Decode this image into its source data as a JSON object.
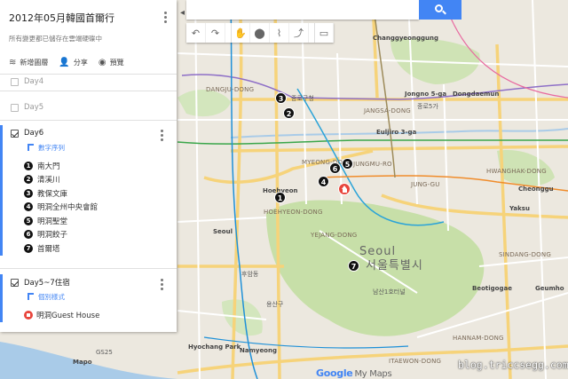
{
  "panel": {
    "title": "2012年05月韓國首爾行",
    "status": "所有變更都已儲存在雲端硬碟中",
    "actions": [
      {
        "label": "新增圖層",
        "icon": "layers-icon"
      },
      {
        "label": "分享",
        "icon": "add-person-icon"
      },
      {
        "label": "預覽",
        "icon": "eye-icon"
      }
    ],
    "layers_collapsed": [
      {
        "label": "Day4",
        "checked": false
      },
      {
        "label": "Day5",
        "checked": false
      }
    ],
    "day6": {
      "label": "Day6",
      "style_label": "數字序列",
      "places": [
        {
          "num": "1",
          "name": "南大門"
        },
        {
          "num": "2",
          "name": "清溪川"
        },
        {
          "num": "3",
          "name": "教保文庫"
        },
        {
          "num": "4",
          "name": "明洞全州中央會館"
        },
        {
          "num": "5",
          "name": "明洞聖堂"
        },
        {
          "num": "6",
          "name": "明洞餃子"
        },
        {
          "num": "7",
          "name": "首爾塔"
        }
      ]
    },
    "stay": {
      "label": "Day5~7住宿",
      "style_label": "個別樣式",
      "place": "明洞Guest House"
    }
  },
  "toolbar": {
    "tools": [
      "undo-icon",
      "redo-icon",
      "hand-icon",
      "marker-icon",
      "line-icon",
      "directions-icon",
      "ruler-icon"
    ]
  },
  "map": {
    "markers": [
      "1",
      "2",
      "3",
      "4",
      "5",
      "6",
      "7"
    ],
    "labels": {
      "changgyeong": "Changgyeonggung",
      "jongno": "Jongno 5-ga",
      "dongdaemun": "Dongdaemun",
      "jongno_ko": "종로5가",
      "jangsa": "JANGSA-DONG",
      "dangju": "DANGJU-DONG",
      "jongno_area": "종로구청",
      "euljiro": "Euljiro 3-ga",
      "myeong": "MYEONG-DONG",
      "jungmu": "JUNGMU-RO",
      "jung": "JUNG-GU",
      "hoehyeon": "Hoehyeon",
      "hoehyeon_dong": "HOEHYEON-DONG",
      "yejang": "YEJANG-DONG",
      "seoul_en": "Seoul",
      "seoul_ko": "서울특별시",
      "namsan": "남산1호터널",
      "seoul_station": "Seoul",
      "huam": "후암동",
      "sindang": "SINDANG-DONG",
      "hwanghak": "HWANGHAK-DONG",
      "itaewon": "ITAEWON-DONG",
      "hyochang": "Hyochang Park",
      "namyeong": "Namyeong",
      "mapo": "Mapo",
      "geumho": "Geumho",
      "beotigogae": "Beotigogae",
      "yaksu": "Yaksu",
      "cheonggu": "Cheonggu",
      "hanam": "HANNAM-DONG",
      "gs25": "GS25",
      "yongsan": "용산구"
    },
    "footer_logo_google": "Google",
    "footer_logo_tail": "My Maps"
  },
  "watermark": "blog.triccsegg.com",
  "colors": {
    "accent": "#4285f4",
    "home_marker": "#e8453c",
    "marker": "#111111",
    "park": "#c7dfa8"
  }
}
